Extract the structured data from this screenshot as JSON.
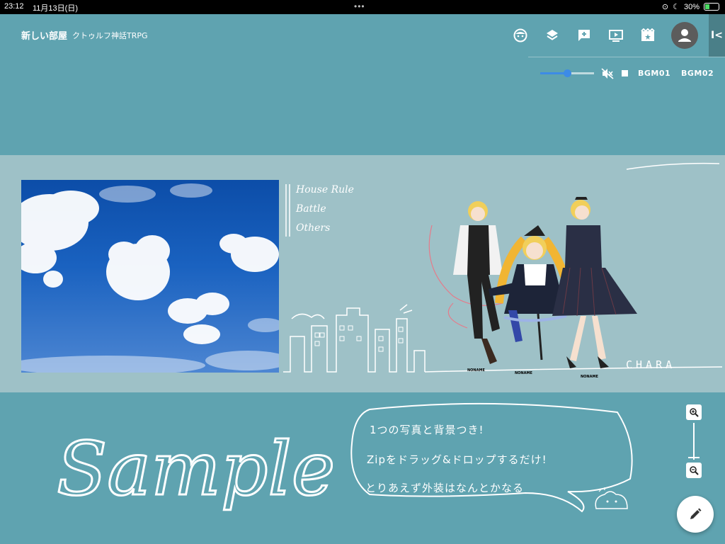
{
  "status_bar": {
    "time": "23:12",
    "date": "11月13日(日)",
    "battery": "30%",
    "battery_level": 0.3
  },
  "header": {
    "room_name": "新しい部屋",
    "system": "クトゥルフ神話TRPG",
    "toolbar_icons": [
      "face-icon",
      "layers-icon",
      "add-comment-icon",
      "screen-icon",
      "scene-icon"
    ],
    "collapse_label": "I<"
  },
  "audio": {
    "volume": 0.5,
    "bgm1": "BGM01",
    "bgm2": "BGM02"
  },
  "scene": {
    "house_rule_items": [
      "House Rule",
      "Battle",
      "Others"
    ],
    "chara_label": "CHARA",
    "noname_labels": [
      "NONAME",
      "NONAME",
      "NONAME"
    ]
  },
  "sample": {
    "title": "Sample",
    "bubble_lines": [
      "1つの写真と背景つき!",
      "Zipをドラッグ&ドロップするだけ!",
      "とりあえず外装はなんとかなる"
    ]
  },
  "colors": {
    "background": "#5fa3b0",
    "band": "#9ec1c7",
    "accent": "#3d8be6"
  }
}
